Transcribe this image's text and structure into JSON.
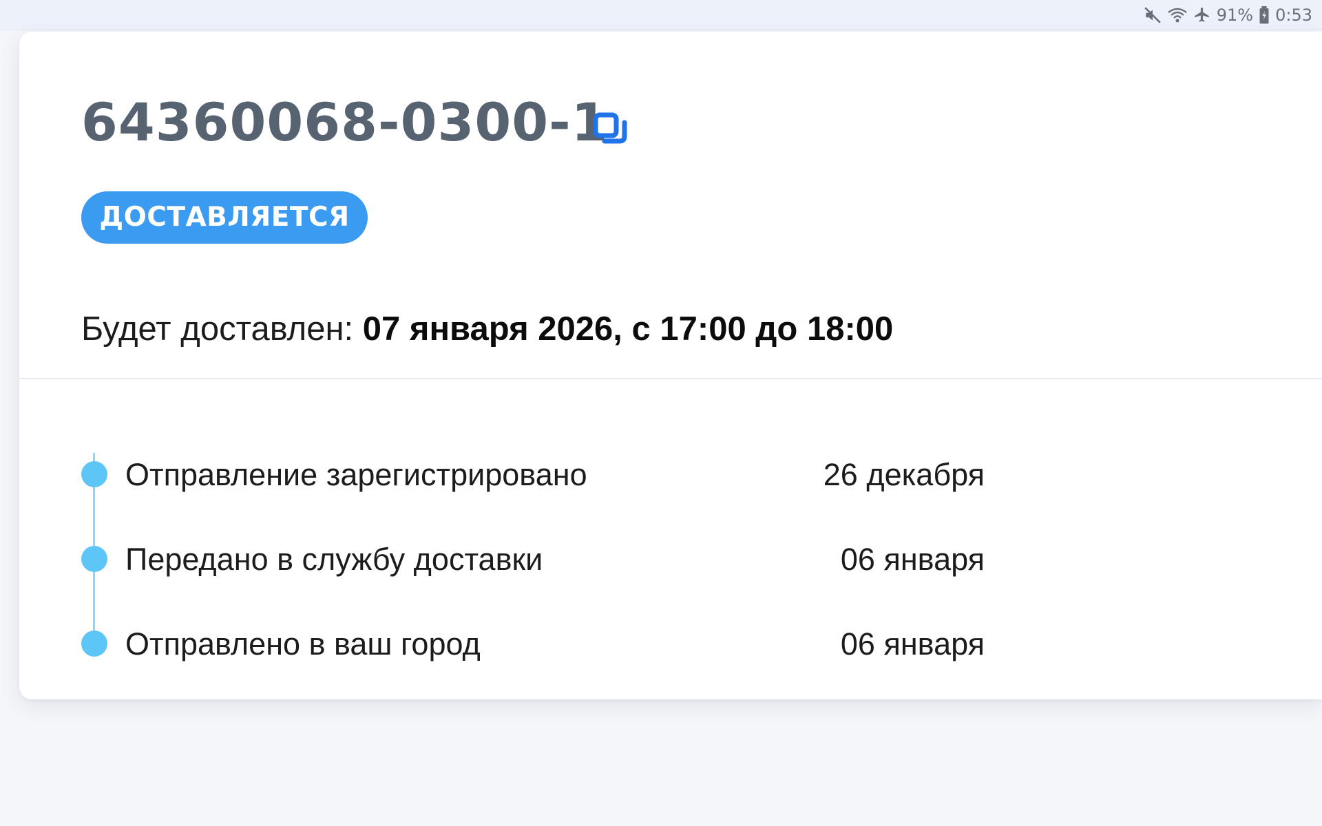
{
  "status_bar": {
    "battery_text": "91%",
    "time": "0:53",
    "icons": [
      "mute-icon",
      "wifi-icon",
      "airplane-icon",
      "battery-icon"
    ]
  },
  "order": {
    "number": "64360068-0300-1",
    "copy_icon": "copy-icon",
    "status": "ДОСТАВЛЯЕТСЯ",
    "delivery_label": "Будет доставлен: ",
    "delivery_value": "07 января 2026, с 17:00 до 18:00"
  },
  "timeline": [
    {
      "label": "Отправление зарегистрировано",
      "date": "26 декабря"
    },
    {
      "label": "Передано в службу доставки",
      "date": "06 января"
    },
    {
      "label": "Отправлено в ваш город",
      "date": "06 января"
    }
  ],
  "colors": {
    "accent": "#3a9bf0",
    "timeline_dot": "#5ec6f7",
    "order_number": "#586372",
    "copy_icon": "#1e73e8"
  }
}
